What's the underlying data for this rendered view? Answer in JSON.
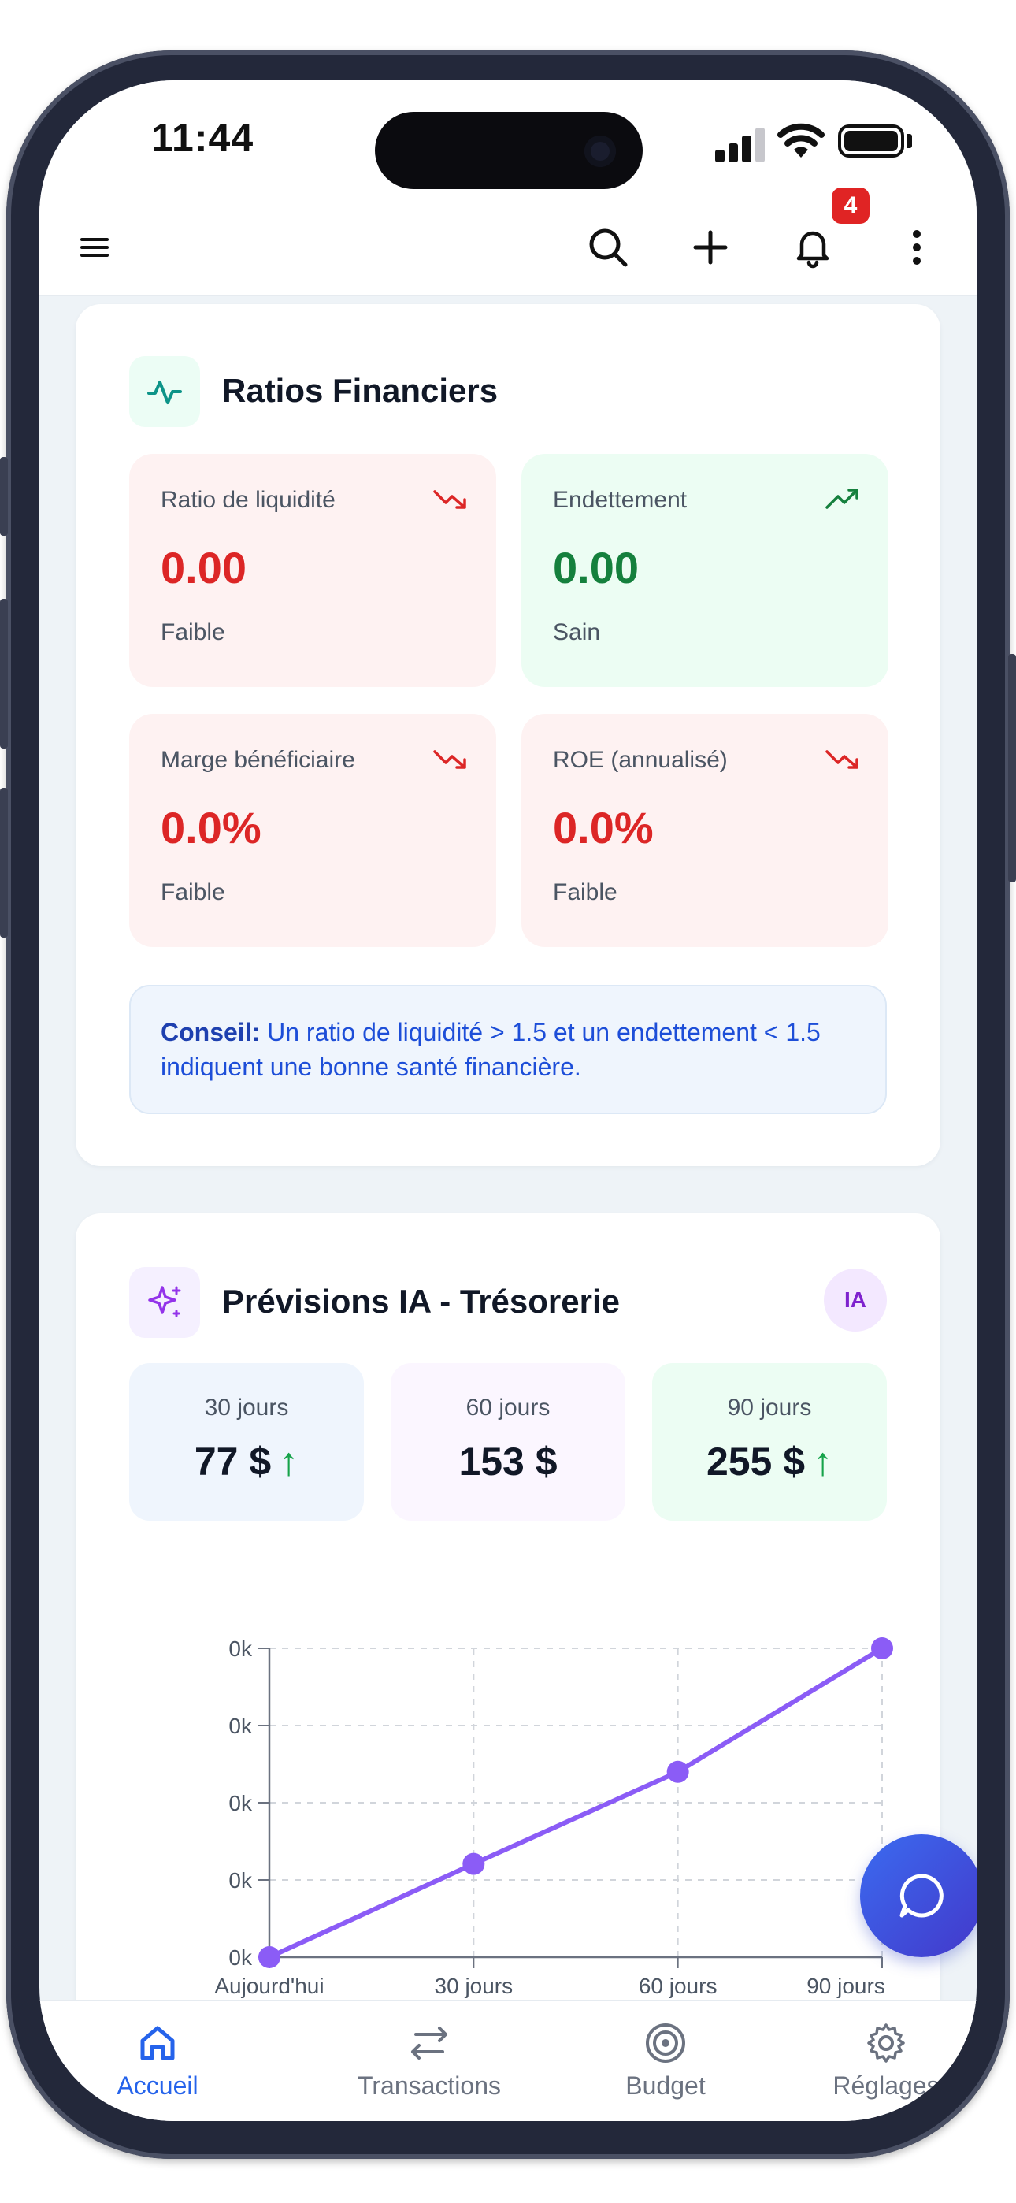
{
  "status_bar": {
    "time": "11:44"
  },
  "header": {
    "notification_count": "4"
  },
  "ratios": {
    "title": "Ratios Financiers",
    "tiles": [
      {
        "label": "Ratio de liquidité",
        "value": "0.00",
        "status": "Faible",
        "trend": "down"
      },
      {
        "label": "Endettement",
        "value": "0.00",
        "status": "Sain",
        "trend": "up"
      },
      {
        "label": "Marge bénéficiaire",
        "value": "0.0%",
        "status": "Faible",
        "trend": "down"
      },
      {
        "label": "ROE (annualisé)",
        "value": "0.0%",
        "status": "Faible",
        "trend": "down"
      }
    ],
    "tip_label": "Conseil:",
    "tip_text": " Un ratio de liquidité > 1.5 et un endettement < 1.5 indiquent une bonne santé financière."
  },
  "forecast": {
    "title": "Prévisions IA - Trésorerie",
    "badge": "IA",
    "tiles": [
      {
        "period": "30 jours",
        "amount": "77 $",
        "arrow": "↑"
      },
      {
        "period": "60 jours",
        "amount": "153 $",
        "arrow": ""
      },
      {
        "period": "90 jours",
        "amount": "255 $",
        "arrow": "↑"
      }
    ]
  },
  "chart_data": {
    "type": "line",
    "categories": [
      "Aujourd'hui",
      "30 jours",
      "60 jours",
      "90 jours"
    ],
    "values": [
      0,
      77,
      153,
      255
    ],
    "y_tick_labels": [
      "0k",
      "0k",
      "0k",
      "0k",
      "0k"
    ],
    "ylim": [
      0,
      255
    ],
    "grid": true,
    "line_color": "#8b5cf6"
  },
  "nav": {
    "items": [
      {
        "label": "Accueil",
        "active": true
      },
      {
        "label": "Transactions",
        "active": false
      },
      {
        "label": "Budget",
        "active": false
      },
      {
        "label": "Réglages",
        "active": false
      }
    ]
  },
  "colors": {
    "danger": "#dc2626",
    "success": "#15803d",
    "accent": "#2563eb",
    "purple": "#8b5cf6"
  }
}
